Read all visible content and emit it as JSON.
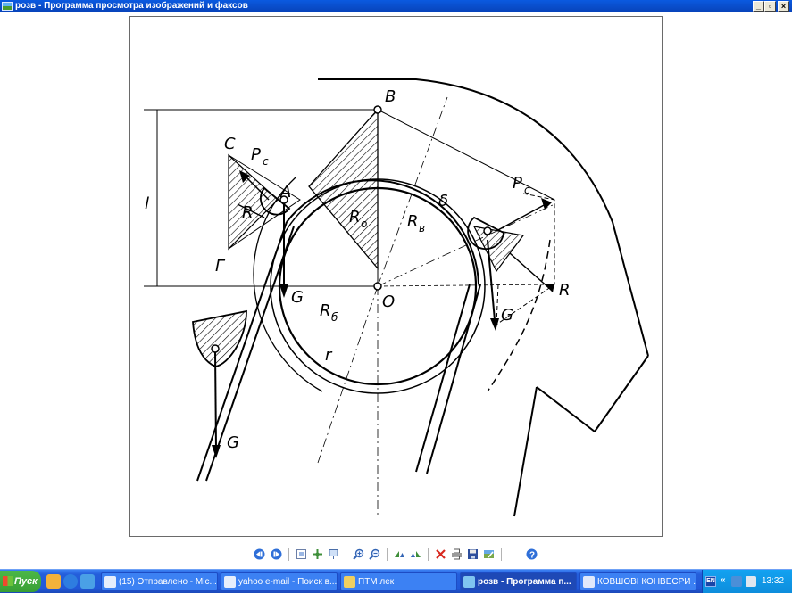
{
  "window": {
    "title": "розв - Программа просмотра изображений и факсов",
    "min_glyph": "_",
    "max_glyph": "▫",
    "close_glyph": "×"
  },
  "figure": {
    "labels": {
      "B": "B",
      "C": "C",
      "Pc1": "P",
      "Pc_sub": "c",
      "A": "A",
      "R1": "R",
      "l": "l",
      "G_upper": "Г",
      "G1": "G",
      "O": "O",
      "R0": "R",
      "R0_sub": "o",
      "Rv": "R",
      "Rv_sub": "в",
      "delta": "δ",
      "Rb": "R",
      "Rb_sub": "б",
      "r": "r",
      "Pc2": "P",
      "Pc2_sub": "c",
      "R2": "R",
      "G2": "G",
      "G3": "G"
    }
  },
  "viewer_toolbar": {
    "buttons": [
      "prev-image",
      "next-image",
      "best-fit",
      "actual-size",
      "slideshow",
      "zoom-in",
      "zoom-out",
      "rotate-clockwise",
      "rotate-counterclockwise",
      "delete",
      "print",
      "save",
      "edit",
      "help"
    ]
  },
  "taskbar": {
    "start_label": "Пуск",
    "tasks": [
      {
        "label": "(15) Отправлено - Mic..."
      },
      {
        "label": "yahoo e-mail - Поиск в..."
      },
      {
        "label": "ПТМ лек"
      },
      {
        "label": "розв - Программа п..."
      },
      {
        "label": "КОВШОВІ КОНВЕЄРИ ..."
      }
    ],
    "tray": {
      "lang": "EN",
      "chevron": "«",
      "clock": "13:32"
    }
  },
  "colors": {
    "titlebar": "#0a5ae0",
    "taskbar": "#245edb",
    "start": "#389e34",
    "tray": "#0d8ddc"
  }
}
